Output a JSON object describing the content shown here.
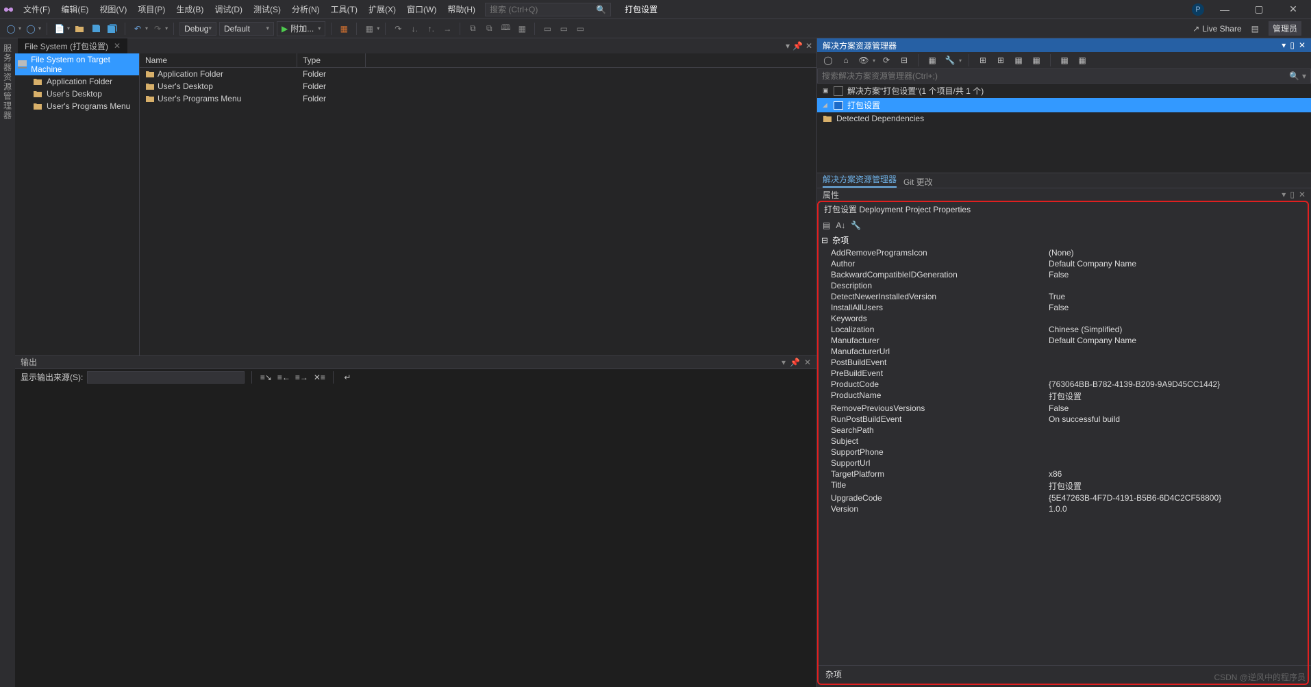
{
  "menu": {
    "items": [
      "文件(F)",
      "编辑(E)",
      "视图(V)",
      "项目(P)",
      "生成(B)",
      "调试(D)",
      "测试(S)",
      "分析(N)",
      "工具(T)",
      "扩展(X)",
      "窗口(W)",
      "帮助(H)"
    ]
  },
  "search": {
    "placeholder": "搜索 (Ctrl+Q)"
  },
  "context_title": "打包设置",
  "title_right": {
    "avatar_letter": "P",
    "admin": "管理员"
  },
  "toolbar": {
    "config": "Debug",
    "platform": "Default",
    "run_label": "附加...",
    "liveshare": "Live Share"
  },
  "doctab": {
    "label": "File System (打包设置)"
  },
  "filesystem": {
    "root": "File System on Target Machine",
    "tree": [
      "Application Folder",
      "User's Desktop",
      "User's Programs Menu"
    ],
    "columns": {
      "name": "Name",
      "type": "Type"
    },
    "rows": [
      {
        "name": "Application Folder",
        "type": "Folder"
      },
      {
        "name": "User's Desktop",
        "type": "Folder"
      },
      {
        "name": "User's Programs Menu",
        "type": "Folder"
      }
    ]
  },
  "output": {
    "title": "输出",
    "source_label": "显示输出来源(S):"
  },
  "solution_explorer": {
    "title": "解决方案资源管理器",
    "search_placeholder": "搜索解决方案资源管理器(Ctrl+;)",
    "sln": "解决方案\"打包设置\"(1 个项目/共 1 个)",
    "project": "打包设置",
    "dep": "Detected Dependencies",
    "tabs": [
      "解决方案资源管理器",
      "Git 更改"
    ]
  },
  "properties": {
    "title": "属性",
    "header": "打包设置  Deployment Project Properties",
    "category": "杂项",
    "rows": [
      {
        "k": "AddRemoveProgramsIcon",
        "v": "(None)"
      },
      {
        "k": "Author",
        "v": "Default Company Name"
      },
      {
        "k": "BackwardCompatibleIDGeneration",
        "v": "False"
      },
      {
        "k": "Description",
        "v": ""
      },
      {
        "k": "DetectNewerInstalledVersion",
        "v": "True"
      },
      {
        "k": "InstallAllUsers",
        "v": "False"
      },
      {
        "k": "Keywords",
        "v": ""
      },
      {
        "k": "Localization",
        "v": "Chinese (Simplified)"
      },
      {
        "k": "Manufacturer",
        "v": "Default Company Name"
      },
      {
        "k": "ManufacturerUrl",
        "v": ""
      },
      {
        "k": "PostBuildEvent",
        "v": ""
      },
      {
        "k": "PreBuildEvent",
        "v": ""
      },
      {
        "k": "ProductCode",
        "v": "{763064BB-B782-4139-B209-9A9D45CC1442}"
      },
      {
        "k": "ProductName",
        "v": "打包设置"
      },
      {
        "k": "RemovePreviousVersions",
        "v": "False"
      },
      {
        "k": "RunPostBuildEvent",
        "v": "On successful build"
      },
      {
        "k": "SearchPath",
        "v": ""
      },
      {
        "k": "Subject",
        "v": ""
      },
      {
        "k": "SupportPhone",
        "v": ""
      },
      {
        "k": "SupportUrl",
        "v": ""
      },
      {
        "k": "TargetPlatform",
        "v": "x86"
      },
      {
        "k": "Title",
        "v": "打包设置"
      },
      {
        "k": "UpgradeCode",
        "v": "{5E47263B-4F7D-4191-B5B6-6D4C2CF58800}"
      },
      {
        "k": "Version",
        "v": "1.0.0"
      }
    ],
    "desc": "杂项"
  },
  "sidegutter": "服务器资源管理器",
  "watermark": "CSDN @逆风中的程序员"
}
